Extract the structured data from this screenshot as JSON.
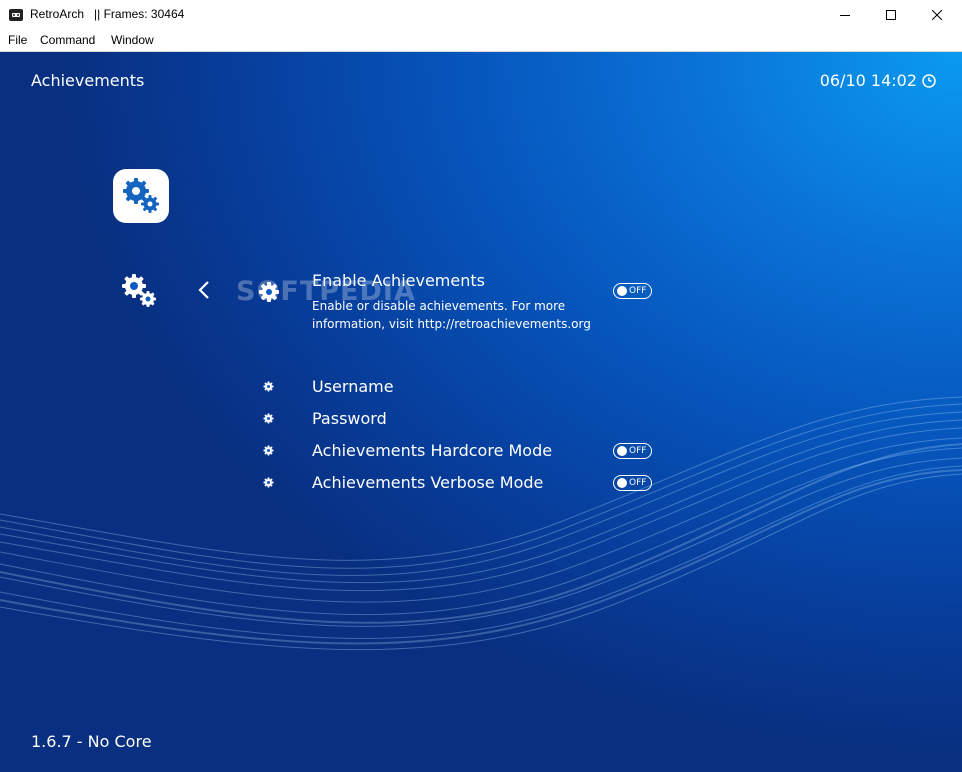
{
  "window": {
    "title": "RetroArch   || Frames: 30464",
    "menu": [
      "File",
      "Command",
      "Window"
    ]
  },
  "header": {
    "title": "Achievements",
    "clock": "06/10 14:02"
  },
  "watermark": "SOFTPEDIA",
  "items": [
    {
      "label": "Enable Achievements",
      "sublabel": "Enable or disable achievements. For more information, visit http://retroachievements.org",
      "toggle": "OFF"
    },
    {
      "label": "Username"
    },
    {
      "label": "Password"
    },
    {
      "label": "Achievements Hardcore Mode",
      "toggle": "OFF"
    },
    {
      "label": "Achievements Verbose Mode",
      "toggle": "OFF"
    }
  ],
  "footer": {
    "version": "1.6.7 - No Core"
  },
  "colors": {
    "background_top_right": "#0a9bf0",
    "background_bottom_left": "#082f80",
    "text": "#ffffff"
  }
}
